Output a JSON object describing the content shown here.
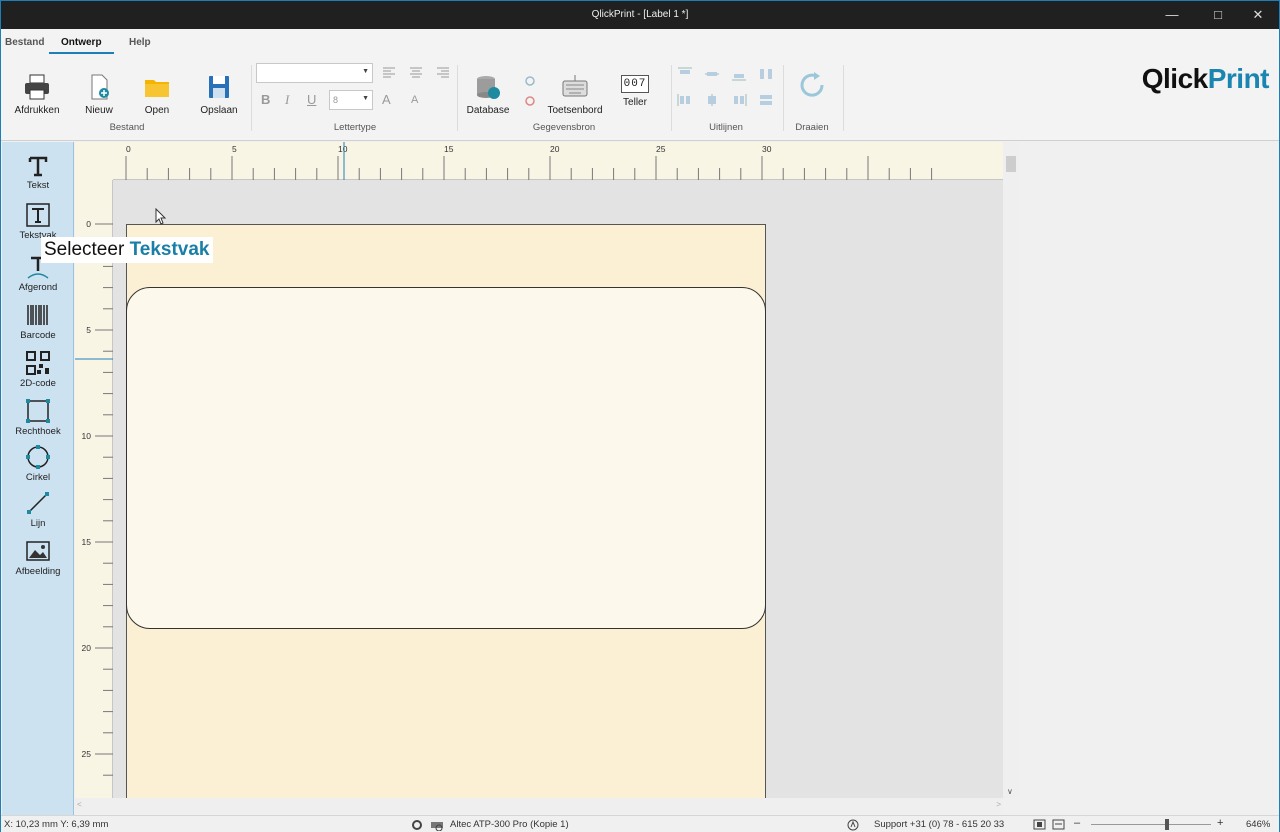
{
  "window": {
    "title": "QlickPrint - [Label 1 *]"
  },
  "menu": {
    "tabs": [
      "Bestand",
      "Ontwerp",
      "Help"
    ],
    "active": "Ontwerp"
  },
  "ribbon": {
    "groups": {
      "bestand": "Bestand",
      "lettertype": "Lettertype",
      "gegevensbron": "Gegevensbron",
      "uitlijnen": "Uitlijnen",
      "draaien": "Draaien"
    },
    "buttons": {
      "print": "Afdrukken",
      "new": "Nieuw",
      "open": "Open",
      "save": "Opslaan",
      "database": "Database",
      "keyboard": "Toetsenbord",
      "counter": "Teller"
    },
    "font_size_value": "8",
    "counter_digits": "007",
    "format": {
      "bold": "B",
      "italic": "I",
      "underline": "U",
      "grow": "A",
      "shrink": "A"
    }
  },
  "brand": {
    "part1": "Qlick",
    "part2": "Print",
    "accent_color": "#1a85b0"
  },
  "toolbox": {
    "items": [
      {
        "label": "Tekst",
        "icon": "text-icon"
      },
      {
        "label": "Tekstvak",
        "icon": "textbox-icon"
      },
      {
        "label": "Afgerond",
        "icon": "rounded-text-icon"
      },
      {
        "label": "Barcode",
        "icon": "barcode-icon"
      },
      {
        "label": "2D-code",
        "icon": "qr-code-icon"
      },
      {
        "label": "Rechthoek",
        "icon": "rectangle-icon"
      },
      {
        "label": "Cirkel",
        "icon": "circle-icon"
      },
      {
        "label": "Lijn",
        "icon": "line-icon"
      },
      {
        "label": "Afbeelding",
        "icon": "image-icon"
      }
    ]
  },
  "ruler": {
    "h_labels": [
      "0",
      "5",
      "10",
      "15",
      "20",
      "25",
      "30"
    ],
    "v_labels": [
      "0",
      "5",
      "10",
      "15",
      "20",
      "25"
    ]
  },
  "tooltip": {
    "prefix": "Selecteer",
    "highlight": "Tekstvak"
  },
  "status": {
    "coords": "X: 10,23 mm Y: 6,39 mm",
    "printer": "Altec ATP-300 Pro (Kopie 1)",
    "support": "Support +31 (0) 78 - 615 20 33",
    "zoom": "646%",
    "zoom_minus": "–",
    "zoom_plus": "+"
  }
}
